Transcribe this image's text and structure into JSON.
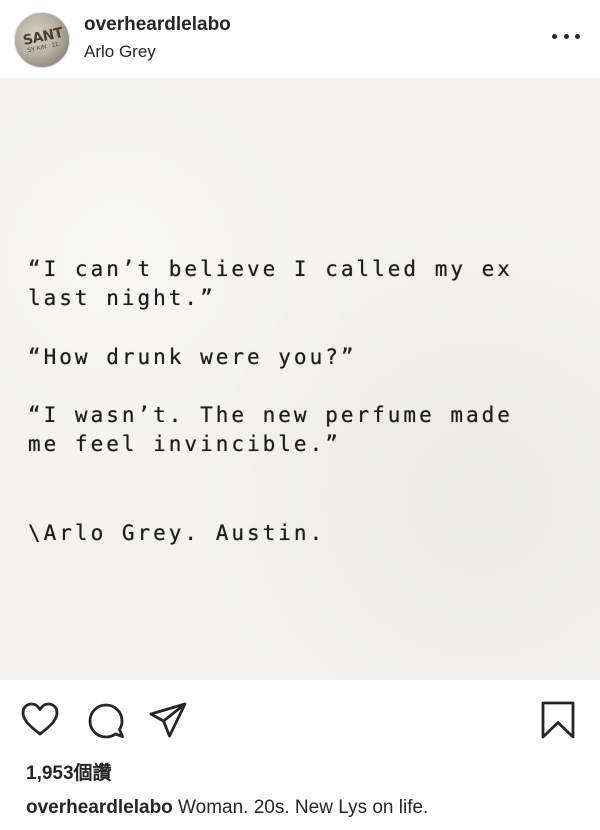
{
  "header": {
    "username": "overheardlelabo",
    "location": "Arlo Grey",
    "avatar_icon": "le-labo-logo-icon",
    "avatar_text": "SANT",
    "avatar_subtext": "SY KIN · 21",
    "more_icon": "more-horizontal-icon"
  },
  "post": {
    "lines": [
      "“I can’t believe I called my ex",
      "last night.”",
      "“How drunk were you?”",
      "“I wasn’t. The new perfume made",
      "me feel invincible.”",
      "\\Arlo Grey. Austin."
    ],
    "background_color": "#f3f2f0"
  },
  "actions": {
    "like_icon": "heart-icon",
    "comment_icon": "comment-icon",
    "share_icon": "paper-plane-icon",
    "save_icon": "bookmark-icon"
  },
  "likes": "1,953個讚",
  "caption": {
    "username": "overheardlelabo",
    "text": " Woman. 20s. New Lys on life."
  }
}
